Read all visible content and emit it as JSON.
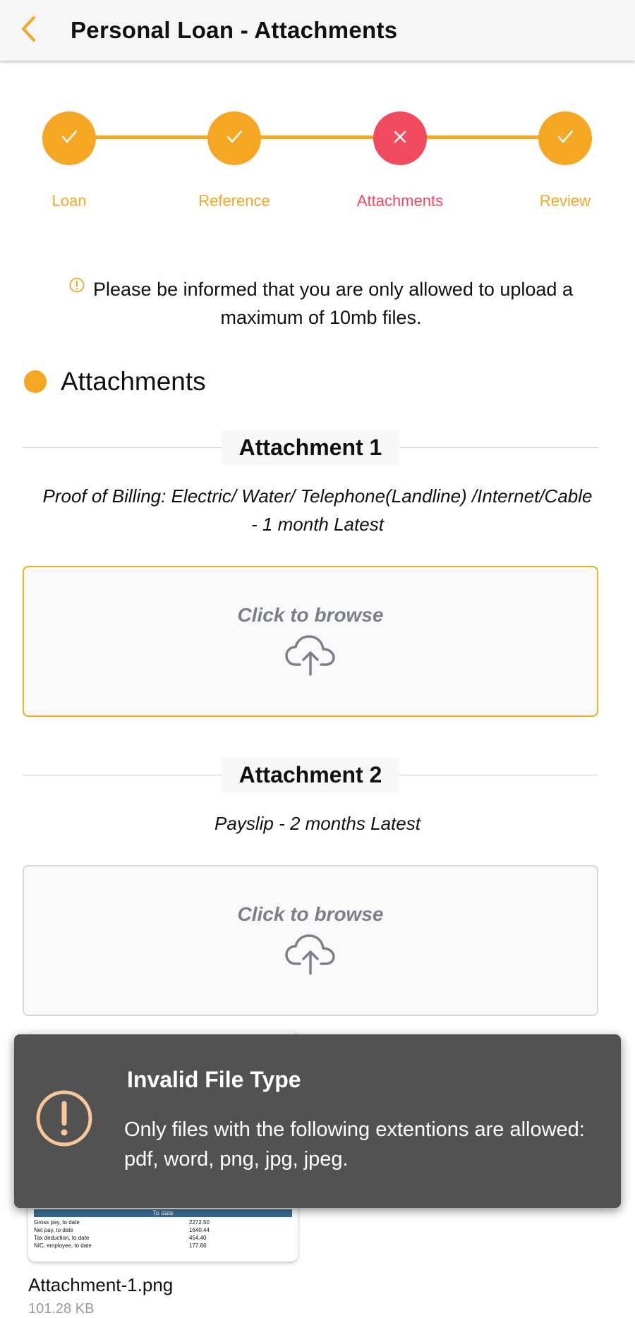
{
  "header": {
    "title": "Personal Loan - Attachments"
  },
  "colors": {
    "accent": "#f5a623",
    "error": "#f24a5e",
    "toast_bg": "#525252"
  },
  "stepper": {
    "steps": [
      {
        "label": "Loan",
        "state": "done",
        "icon": "check-icon"
      },
      {
        "label": "Reference",
        "state": "done",
        "icon": "check-icon"
      },
      {
        "label": "Attachments",
        "state": "error",
        "icon": "x-icon"
      },
      {
        "label": "Review",
        "state": "done",
        "icon": "check-icon"
      }
    ]
  },
  "notice": {
    "text": "Please be informed that you are only allowed to upload a maximum of 10mb files."
  },
  "section": {
    "title": "Attachments"
  },
  "attachments": [
    {
      "title": "Attachment 1",
      "description": "Proof of Billing: Electric/ Water/ Telephone(Landline) /Internet/Cable - 1 month Latest",
      "browse_label": "Click to browse"
    },
    {
      "title": "Attachment 2",
      "description": "Payslip - 2 months Latest",
      "browse_label": "Click to browse"
    }
  ],
  "uploaded_file": {
    "name": "Attachment-1.png",
    "size": "101.28 KB",
    "preview": {
      "header": "To date",
      "rows": [
        {
          "label": "Gross pay, to date",
          "value": "2272.50"
        },
        {
          "label": "Net pay, to date",
          "value": "1640.44"
        },
        {
          "label": "Tax deduction, to date",
          "value": "454.40"
        },
        {
          "label": "NIC, employee, to date",
          "value": "177.66"
        }
      ]
    }
  },
  "toast": {
    "title": "Invalid File Type",
    "message": "Only files with the following extentions are allowed: pdf, word, png, jpg, jpeg."
  }
}
